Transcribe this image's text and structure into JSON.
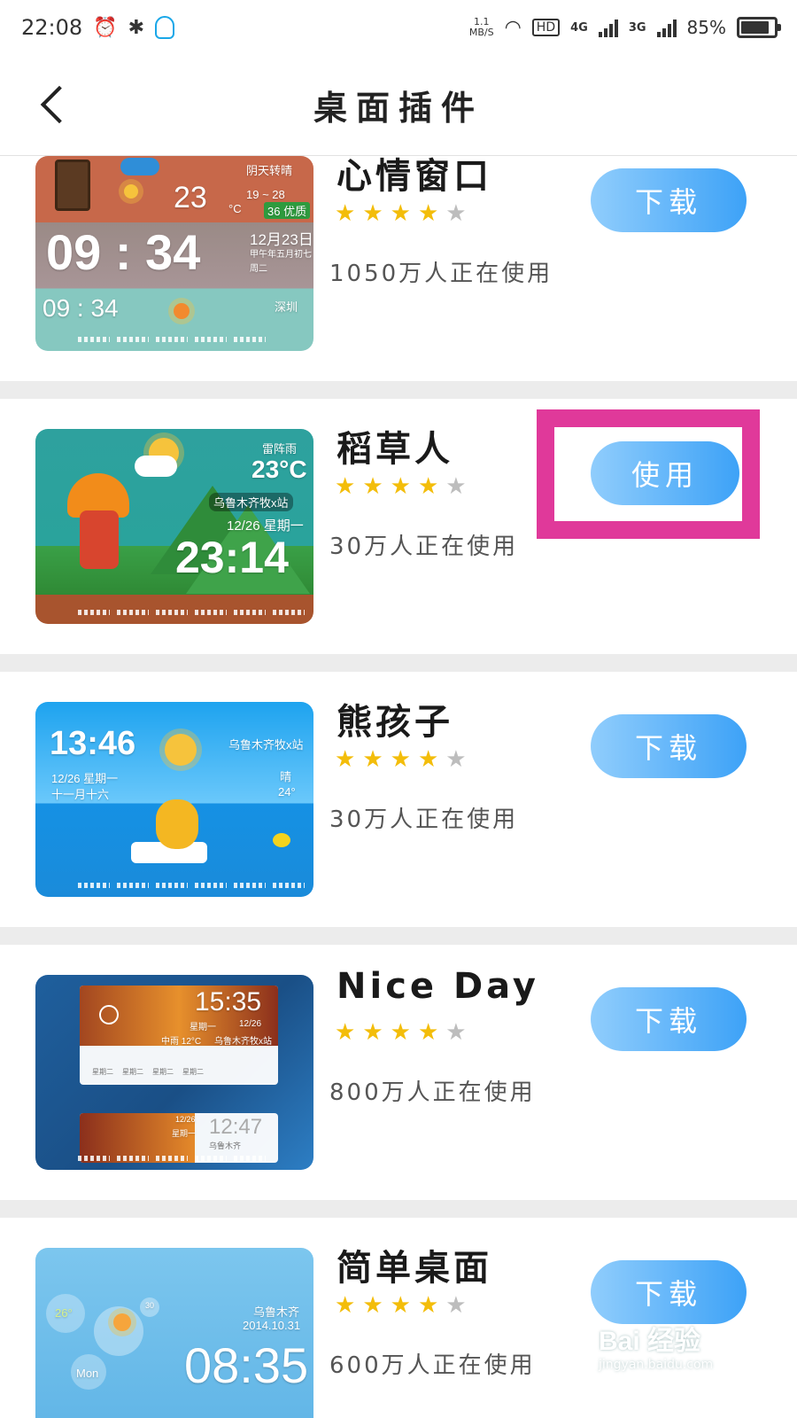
{
  "status_bar": {
    "time": "22:08",
    "speed_top": "1.1",
    "speed_bottom": "MB/S",
    "hd": "HD",
    "net1": "4G",
    "net2": "3G",
    "battery": "85%",
    "battery_level": 0.85
  },
  "header": {
    "back_icon": "chevron-left",
    "title": "桌面插件"
  },
  "items": [
    {
      "name": "心情窗口",
      "rating": 4,
      "max_rating": 5,
      "users": "1050万人正在使用",
      "action": "下载",
      "thumb": {
        "weather": "阴天转晴",
        "temp": "23",
        "unit": "°C",
        "range": "19 ~ 28",
        "aqi": "36 优质",
        "time": "09 : 34",
        "date": "12月23日",
        "lunar": "甲午年五月初七",
        "weekday": "周二",
        "time_small": "09 : 34",
        "city": "深圳"
      }
    },
    {
      "name": "稻草人",
      "rating": 4,
      "max_rating": 5,
      "users": "30万人正在使用",
      "action": "使用",
      "thumb": {
        "weather": "雷阵雨",
        "temp": "23°C",
        "station": "乌鲁木齐牧x站",
        "date": "12/26 星期一",
        "time": "23:14"
      }
    },
    {
      "name": "熊孩子",
      "rating": 4,
      "max_rating": 5,
      "users": "30万人正在使用",
      "action": "下载",
      "thumb": {
        "time": "13:46",
        "station": "乌鲁木齐牧x站",
        "date": "12/26 星期一",
        "lunar": "十一月十六",
        "weather": "晴",
        "temp": "24°"
      }
    },
    {
      "name": "Nice Day",
      "rating": 4,
      "max_rating": 5,
      "users": "800万人正在使用",
      "action": "下载",
      "thumb": {
        "time": "15:35",
        "weekday": "星期一",
        "date": "12/26",
        "weather": "中雨 12°C",
        "station": "乌鲁木齐牧x站",
        "forecast": [
          "星期二",
          "星期二",
          "星期二",
          "星期二"
        ],
        "time_small": "12:47",
        "date_small": "12/26",
        "weekday_small": "星期一",
        "station_small": "乌鲁木齐"
      }
    },
    {
      "name": "简单桌面",
      "rating": 4,
      "max_rating": 5,
      "users": "600万人正在使用",
      "action": "下载",
      "thumb": {
        "temp": "26°",
        "station": "乌鲁木齐",
        "date": "2014.10.31",
        "time": "08:35",
        "day": "Mon",
        "badge": "30"
      }
    }
  ],
  "highlight_color": "#e0399a",
  "accent": "#3da2f7",
  "watermark": {
    "main": "Bai 经验",
    "sub": "jingyan.baidu.com"
  }
}
